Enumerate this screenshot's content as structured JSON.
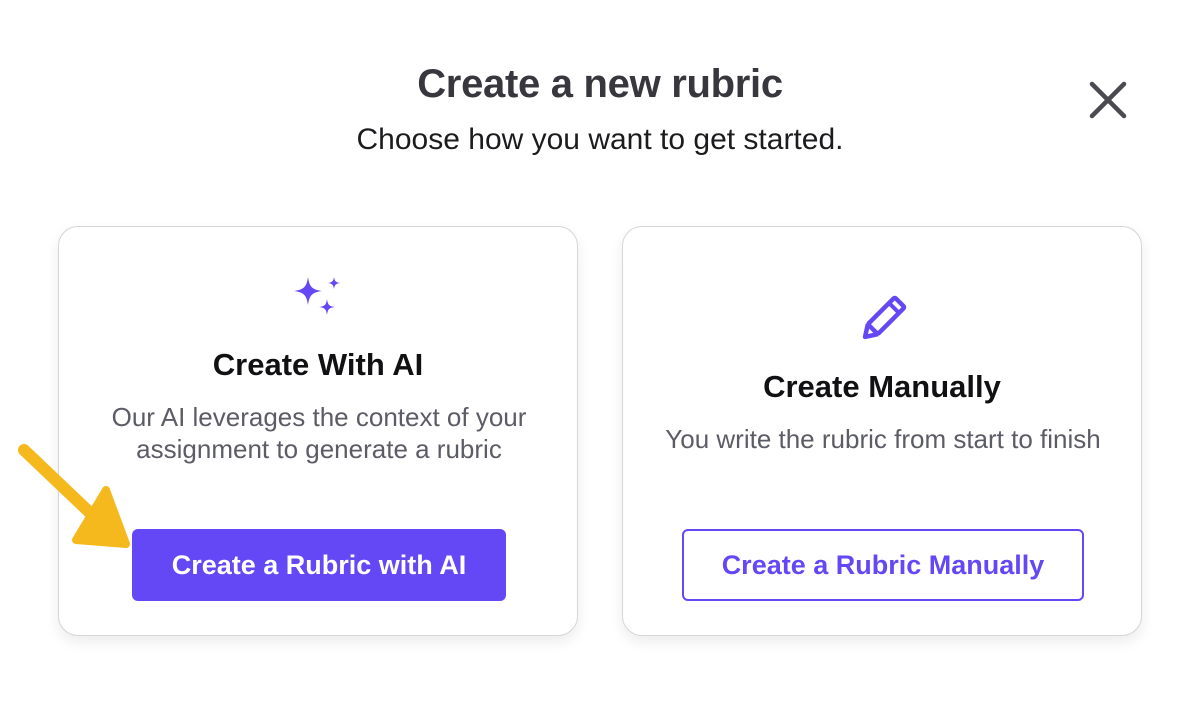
{
  "dialog": {
    "title": "Create a new rubric",
    "subtitle": "Choose how you want to get started.",
    "close_icon": "close-icon"
  },
  "options": {
    "ai": {
      "icon": "sparkles-icon",
      "title": "Create With AI",
      "description": "Our AI leverages the context of your assignment to generate a rubric",
      "button_label": "Create a Rubric with AI"
    },
    "manual": {
      "icon": "pencil-icon",
      "title": "Create Manually",
      "description": "You write the rubric from start to finish",
      "button_label": "Create a Rubric Manually"
    }
  },
  "annotation": {
    "icon": "arrow-pointer-icon",
    "color": "#f6b91d"
  },
  "colors": {
    "accent": "#6548f5",
    "card_border": "#d6d6db",
    "title_text": "#37373d",
    "muted_text": "#5c5c66"
  }
}
